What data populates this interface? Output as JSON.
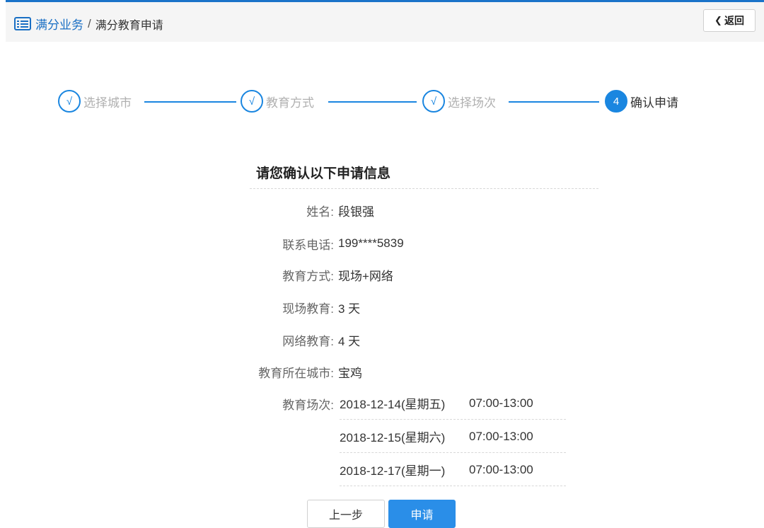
{
  "header": {
    "breadcrumb_parent": "满分业务",
    "breadcrumb_sep": "/",
    "breadcrumb_current": "满分教育申请",
    "back_label": "返回"
  },
  "steps": [
    {
      "mark": "√",
      "label": "选择城市",
      "state": "done"
    },
    {
      "mark": "√",
      "label": "教育方式",
      "state": "done"
    },
    {
      "mark": "√",
      "label": "选择场次",
      "state": "done"
    },
    {
      "mark": "4",
      "label": "确认申请",
      "state": "active"
    }
  ],
  "confirm": {
    "title": "请您确认以下申请信息",
    "fields": [
      {
        "key": "姓名:",
        "value": "段银强"
      },
      {
        "key": "联系电话:",
        "value": "199****5839"
      },
      {
        "key": "教育方式:",
        "value": "现场+网络"
      },
      {
        "key": "现场教育:",
        "value": "3 天"
      },
      {
        "key": "网络教育:",
        "value": "4 天"
      },
      {
        "key": "教育所在城市:",
        "value": "宝鸡"
      }
    ],
    "sessions_label": "教育场次:",
    "sessions": [
      {
        "date": "2018-12-14(星期五)",
        "time": "07:00-13:00"
      },
      {
        "date": "2018-12-15(星期六)",
        "time": "07:00-13:00"
      },
      {
        "date": "2018-12-17(星期一)",
        "time": "07:00-13:00"
      }
    ]
  },
  "actions": {
    "prev_label": "上一步",
    "apply_label": "申请"
  },
  "colors": {
    "accent": "#1a86e0",
    "primary_button": "#2a8ee8",
    "breadcrumb_link": "#1a6fc4",
    "inactive_step_text": "#b0b0b0"
  }
}
